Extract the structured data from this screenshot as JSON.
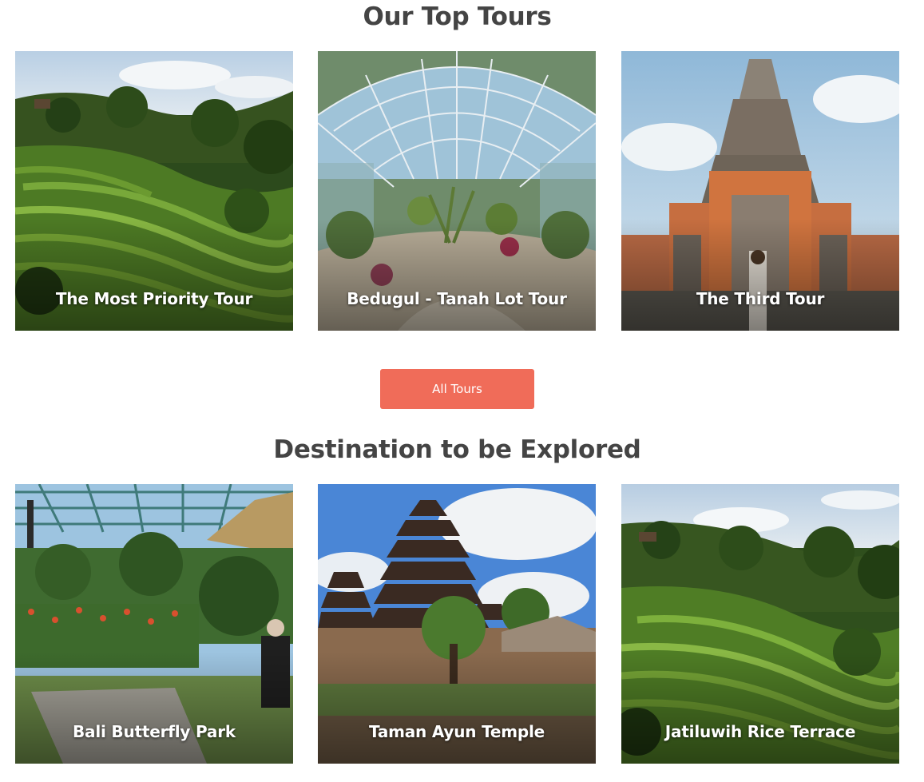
{
  "top_tours": {
    "title": "Our Top Tours",
    "cards": [
      {
        "label": "The Most Priority Tour",
        "image": "rice-terrace-photo"
      },
      {
        "label": "Bedugul - Tanah Lot Tour",
        "image": "greenhouse-garden-photo"
      },
      {
        "label": "The Third Tour",
        "image": "temple-gate-photo"
      }
    ],
    "button_label": "All Tours"
  },
  "destinations": {
    "title": "Destination to be Explored",
    "cards": [
      {
        "label": "Bali Butterfly Park",
        "image": "garden-pergola-photo"
      },
      {
        "label": "Taman Ayun Temple",
        "image": "pagoda-temple-photo"
      },
      {
        "label": "Jatiluwih Rice Terrace",
        "image": "rice-terrace-photo"
      }
    ]
  },
  "colors": {
    "heading": "#444444",
    "button": "#f06c59",
    "caption": "#ffffff"
  }
}
